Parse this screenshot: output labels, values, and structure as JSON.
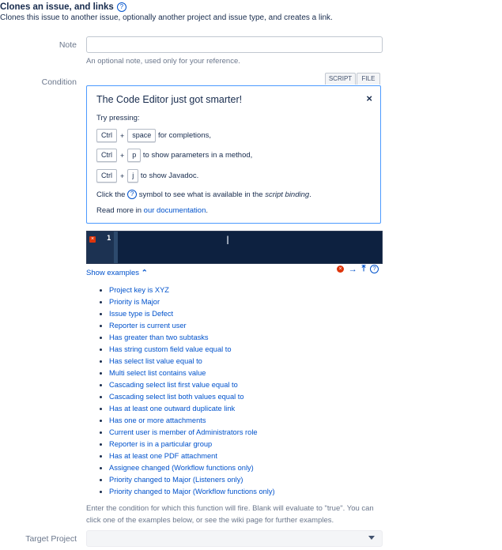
{
  "header": {
    "title": "Clones an issue, and links",
    "help_glyph": "?",
    "subtitle": "Clones this issue to another issue, optionally another project and issue type, and creates a link."
  },
  "note": {
    "label": "Note",
    "value": "",
    "hint": "An optional note, used only for your reference."
  },
  "condition": {
    "label": "Condition",
    "tabs": [
      "SCRIPT",
      "FILE"
    ]
  },
  "popup": {
    "title": "The Code Editor just got smarter!",
    "close": "×",
    "try": "Try pressing:",
    "shortcuts": [
      {
        "mod": "Ctrl",
        "key": "space",
        "text": "for completions,"
      },
      {
        "mod": "Ctrl",
        "key": "p",
        "text": "to show parameters in a method,"
      },
      {
        "mod": "Ctrl",
        "key": "j",
        "text": "to show Javadoc."
      }
    ],
    "plus": "+",
    "binding_pre": "Click the",
    "binding_glyph": "?",
    "binding_mid": "symbol to see what is available in the",
    "binding_em": "script binding",
    "binding_post": ".",
    "read_pre": "Read more in",
    "read_link": "our documentation",
    "read_post": "."
  },
  "editor": {
    "line_number": "1",
    "error_glyph": "×",
    "cursor_glyph": "I"
  },
  "toolbar": {
    "error_glyph": "×",
    "arrow_right": "→",
    "arrow_up": "⤒",
    "help_glyph": "?"
  },
  "examples": {
    "toggle_label": "Show examples",
    "toggle_glyph": "⌃",
    "items": [
      "Project key is XYZ",
      "Priority is Major",
      "Issue type is Defect",
      "Reporter is current user",
      "Has greater than two subtasks",
      "Has string custom field value equal to",
      "Has select list value equal to",
      "Multi select list contains value",
      "Cascading select list first value equal to",
      "Cascading select list both values equal to",
      "Has at least one outward duplicate link",
      "Has one or more attachments",
      "Current user is member of Administrators role",
      "Reporter is in a particular group",
      "Has at least one PDF attachment",
      "Assignee changed (Workflow functions only)",
      "Priority changed to Major (Listeners only)",
      "Priority changed to Major (Workflow functions only)"
    ],
    "description": "Enter the condition for which this function will fire. Blank will evaluate to \"true\". You can click one of the examples below, or see the wiki page for further examples."
  },
  "target_project": {
    "label": "Target Project",
    "value": ""
  },
  "colors": {
    "link": "#0052cc",
    "editor_bg": "#0d2140",
    "error": "#de350b",
    "popup_border": "#4c9aff"
  }
}
